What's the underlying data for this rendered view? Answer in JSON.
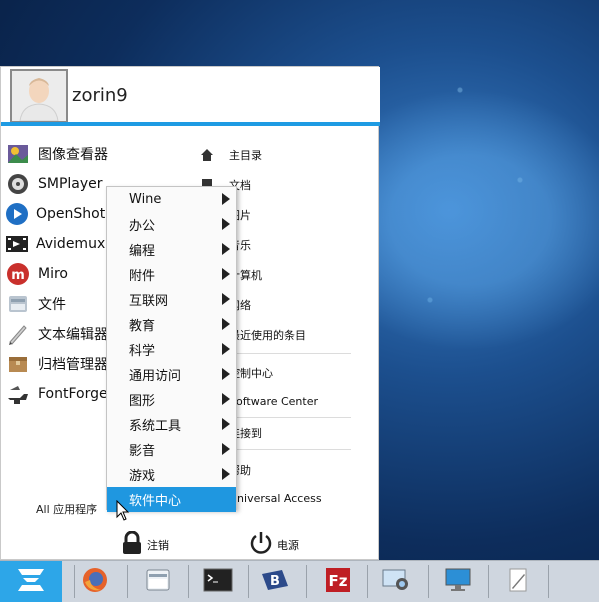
{
  "user": {
    "name": "zorin9"
  },
  "apps": [
    {
      "label": "图像查看器",
      "icon": "image-viewer-icon"
    },
    {
      "label": "SMPlayer",
      "icon": "smplayer-icon"
    },
    {
      "label": "OpenShot V",
      "icon": "openshot-icon"
    },
    {
      "label": "Avidemux (",
      "icon": "avidemux-icon"
    },
    {
      "label": "Miro",
      "icon": "miro-icon"
    },
    {
      "label": "文件",
      "icon": "files-icon"
    },
    {
      "label": "文本编辑器",
      "icon": "text-editor-icon"
    },
    {
      "label": "归档管理器",
      "icon": "archive-manager-icon"
    },
    {
      "label": "FontForge",
      "icon": "fontforge-icon"
    }
  ],
  "all_apps_label": "All 应用程序",
  "places": [
    {
      "label": "主目录",
      "icon": "home-icon"
    },
    {
      "label": "文档",
      "icon": "documents-icon"
    },
    {
      "label": "图片",
      "icon": "pictures-icon"
    },
    {
      "label": "音乐",
      "icon": "music-icon"
    },
    {
      "label": "计算机",
      "icon": "computer-icon"
    },
    {
      "label": "网络",
      "icon": "network-icon"
    },
    {
      "label": "最近使用的条目",
      "icon": "recent-icon"
    },
    {
      "label": "控制中心",
      "icon": "control-center-icon"
    },
    {
      "label": "Software Center",
      "icon": "software-center-icon"
    },
    {
      "label": "连接到",
      "icon": "connect-icon"
    },
    {
      "label": "帮助",
      "icon": "help-icon"
    },
    {
      "label": "Universal Access",
      "icon": "universal-access-icon"
    }
  ],
  "submenu": [
    {
      "label": "Wine",
      "has_arrow": true
    },
    {
      "label": "办公",
      "has_arrow": true
    },
    {
      "label": "编程",
      "has_arrow": true
    },
    {
      "label": "附件",
      "has_arrow": true
    },
    {
      "label": "互联网",
      "has_arrow": true
    },
    {
      "label": "教育",
      "has_arrow": true
    },
    {
      "label": "科学",
      "has_arrow": true
    },
    {
      "label": "通用访问",
      "has_arrow": true
    },
    {
      "label": "图形",
      "has_arrow": true
    },
    {
      "label": "系统工具",
      "has_arrow": true
    },
    {
      "label": "影音",
      "has_arrow": true
    },
    {
      "label": "游戏",
      "has_arrow": true
    },
    {
      "label": "软件中心",
      "has_arrow": false,
      "active": true
    }
  ],
  "bottom": {
    "logout_label": "注销",
    "power_label": "电源"
  },
  "taskbar": {
    "apps": [
      "firefox-icon",
      "file-manager-icon",
      "terminal-icon",
      "bluefish-icon",
      "filezilla-icon",
      "screenshot-icon",
      "remote-desktop-icon",
      "text-editor-icon"
    ]
  },
  "colors": {
    "accent": "#1e9be3",
    "taskbar": "#cfd6df",
    "highlight": "#1f97e0"
  }
}
